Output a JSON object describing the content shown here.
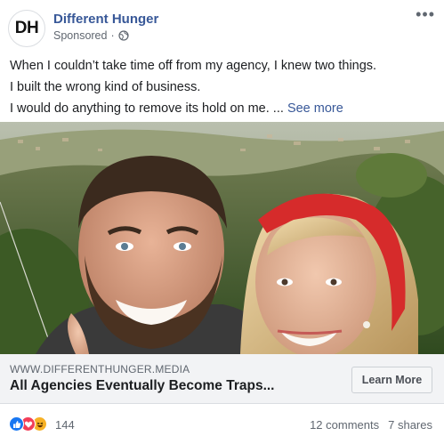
{
  "header": {
    "avatar_initials": "DH",
    "page_name": "Different Hunger",
    "sponsored": "Sponsored",
    "separator": "·",
    "more_icon": "more-horizontal-icon"
  },
  "post": {
    "lines": [
      "When I couldn’t take time off from my agency, I knew two things.",
      "I built the wrong kind of business.",
      "I would do anything to remove its hold on me. ..."
    ],
    "see_more": "See more"
  },
  "link": {
    "domain": "WWW.DIFFERENTHUNGER.MEDIA",
    "headline": "All Agencies Eventually Become Traps...",
    "cta_label": "Learn More"
  },
  "reactions": {
    "icons": [
      "like-icon",
      "love-icon",
      "haha-icon"
    ],
    "count": "144",
    "comments": "12 comments",
    "shares": "7 shares"
  },
  "colors": {
    "link_blue": "#385898",
    "like_blue": "#1877f2",
    "love_red": "#f33e58",
    "haha_yellow": "#f7b125"
  }
}
